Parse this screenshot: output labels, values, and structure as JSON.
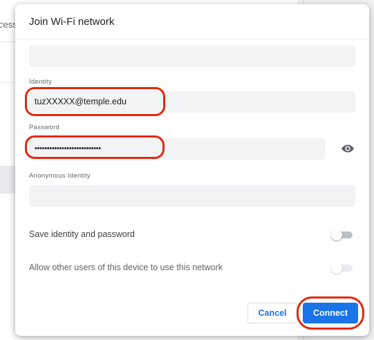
{
  "background": {
    "partial_text": "cess"
  },
  "dialog": {
    "title": "Join Wi-Fi network",
    "fields": {
      "top_value": "",
      "identity_label": "Identity",
      "identity_value": "tuzXXXXX@temple.edu",
      "password_label": "Password",
      "password_value": "•••••••••••••••••••••••••••",
      "anonymous_label": "Anonymous Identity",
      "anonymous_value": ""
    },
    "options": {
      "save_identity_label": "Save identity and password",
      "save_identity_on": false,
      "share_label": "Allow other users of this device to use this network",
      "share_on": false
    },
    "buttons": {
      "cancel": "Cancel",
      "connect": "Connect"
    }
  },
  "colors": {
    "accent": "#1a73e8",
    "highlight": "#e8250c",
    "field_bg": "#f1f3f4",
    "toggle_track_off": "#bdc1c6"
  },
  "icons": {
    "password_toggle": "eye-icon"
  }
}
